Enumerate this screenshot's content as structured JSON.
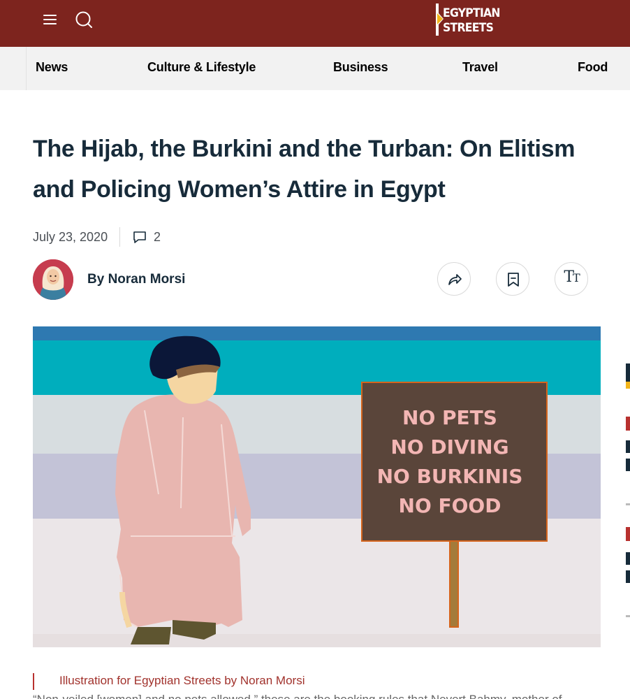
{
  "header": {
    "menu_icon": "hamburger-menu-icon",
    "search_icon": "search-icon",
    "logo_line1": "EGYPTIAN",
    "logo_line2": "STREETS",
    "background_color": "#7d241e"
  },
  "nav": {
    "items": [
      "News",
      "Culture & Lifestyle",
      "Business",
      "Travel",
      "Food"
    ]
  },
  "article": {
    "title": "The Hijab, the Burkini and the Turban: On Elitism and Policing Women’s Attire in Egypt",
    "date": "July 23, 2020",
    "comment_count": "2",
    "author": "By Noran Morsi",
    "actions": {
      "share_icon": "share-icon",
      "bookmark_icon": "bookmark-icon",
      "text_size_icon": "text-size-icon"
    }
  },
  "hero": {
    "sign_lines": [
      "NO PETS",
      "NO DIVING",
      "NO BURKINIS",
      "NO FOOD"
    ]
  },
  "caption": "Illustration for Egyptian Streets by Noran Morsi",
  "body_start": "“Non-veiled [women] and no pets allowed,” these are the booking rules that Nevert Bahmy, mother of"
}
